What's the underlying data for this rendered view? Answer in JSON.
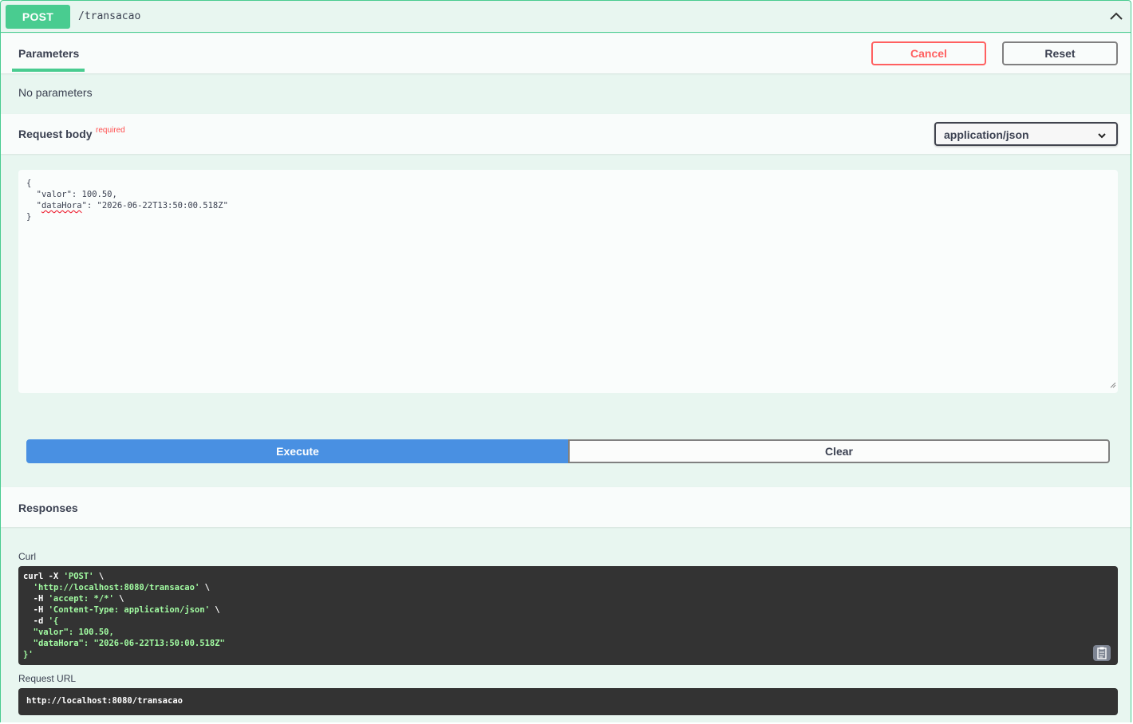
{
  "operation": {
    "method": "POST",
    "path": "/transacao"
  },
  "parameters": {
    "tab_label": "Parameters",
    "cancel_label": "Cancel",
    "reset_label": "Reset",
    "empty_text": "No parameters"
  },
  "request_body": {
    "title": "Request body",
    "required_label": "required",
    "content_type": "application/json",
    "editor_lines": {
      "l1": "{",
      "l2_indent": "  ",
      "l2": "\"valor\": 100.50,",
      "l3_quote_open": "\"",
      "l3_key": "dataHora",
      "l3_rest": "\": \"2026-06-22T13:50:00.518Z\"",
      "l4": "}"
    }
  },
  "actions": {
    "execute_label": "Execute",
    "clear_label": "Clear"
  },
  "responses": {
    "title": "Responses",
    "curl_label": "Curl",
    "curl": {
      "c1a": "curl -X ",
      "c1b": "'POST'",
      "c1c": " \\",
      "c2a": "  ",
      "c2b": "'http://localhost:8080/transacao'",
      "c2c": " \\",
      "c3a": "  -H ",
      "c3b": "'accept: */*'",
      "c3c": " \\",
      "c4a": "  -H ",
      "c4b": "'Content-Type: application/json'",
      "c4c": " \\",
      "c5a": "  -d ",
      "c5b": "'{",
      "c6": "  \"valor\": 100.50,",
      "c7": "  \"dataHora\": \"2026-06-22T13:50:00.518Z\"",
      "c8": "}'"
    },
    "request_url_label": "Request URL",
    "request_url": "http://localhost:8080/transacao"
  },
  "colors": {
    "post_green": "#49cc90",
    "execute_blue": "#4990e2",
    "cancel_red": "#ff6060",
    "code_bg": "#333333",
    "code_string": "#a2fca2"
  },
  "icons": {
    "collapse": "chevron-up-icon",
    "select": "chevron-down-icon",
    "copy": "clipboard-icon",
    "resize": "resize-handle-icon"
  }
}
